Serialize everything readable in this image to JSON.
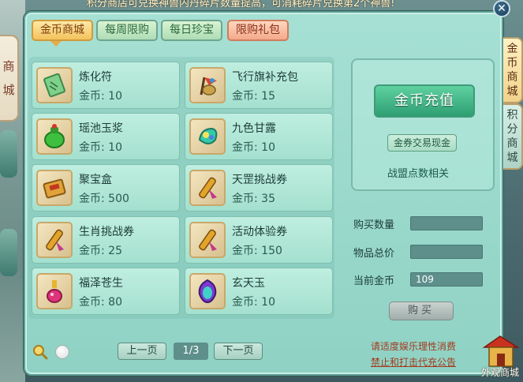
{
  "banner": {
    "text": "积分商店可兑换神兽内丹碎片数量提高，可消耗碎片兑换第2个神兽!"
  },
  "left_strip": {
    "chars": [
      "商",
      "城"
    ]
  },
  "tabs": [
    {
      "label": "金币商城",
      "active": true
    },
    {
      "label": "每周限购",
      "active": false
    },
    {
      "label": "每日珍宝",
      "active": false
    },
    {
      "label": "限购礼包",
      "active": false
    }
  ],
  "items": [
    {
      "name": "炼化符",
      "price": "金币: 10",
      "icon": "talisman-icon"
    },
    {
      "name": "飞行旗补充包",
      "price": "金币: 15",
      "icon": "flag-pack-icon"
    },
    {
      "name": "瑶池玉浆",
      "price": "金币: 10",
      "icon": "jade-jar-icon"
    },
    {
      "name": "九色甘露",
      "price": "金币: 10",
      "icon": "dew-gem-icon"
    },
    {
      "name": "聚宝盒",
      "price": "金币: 500",
      "icon": "treasure-box-icon"
    },
    {
      "name": "天罡挑战券",
      "price": "金币: 35",
      "icon": "scroll-icon"
    },
    {
      "name": "生肖挑战券",
      "price": "金币: 25",
      "icon": "scroll-icon"
    },
    {
      "name": "活动体验券",
      "price": "金币: 150",
      "icon": "scroll-icon"
    },
    {
      "name": "福泽苍生",
      "price": "金币: 80",
      "icon": "potion-icon"
    },
    {
      "name": "玄天玉",
      "price": "金币: 10",
      "icon": "purple-jade-icon"
    }
  ],
  "side": {
    "recharge_label": "金币充值",
    "exchange_label": "金券交易现金",
    "alliance_link": "战盟点数相关",
    "buy_qty_label": "购买数量",
    "buy_qty_value": "",
    "total_label": "物品总价",
    "total_value": "",
    "current_gold_label": "当前金币",
    "current_gold_value": "109",
    "buy_button": "购买"
  },
  "pager": {
    "prev": "上一页",
    "page": "1/3",
    "next": "下一页"
  },
  "notice": {
    "line1": "请适度娱乐理性消费",
    "line2": "禁止和打击代充公告"
  },
  "vertical_tabs": [
    {
      "chars": [
        "金",
        "币",
        "商",
        "城"
      ],
      "active": true
    },
    {
      "chars": [
        "积",
        "分",
        "商",
        "城"
      ],
      "active": false
    }
  ],
  "outer_shop_label": "外观商城",
  "colors": {
    "panel_bg": "#9fdccf",
    "accent_gold": "#f3c25c",
    "recharge_green": "#2e9f72",
    "notice_red": "#a23a1e"
  }
}
